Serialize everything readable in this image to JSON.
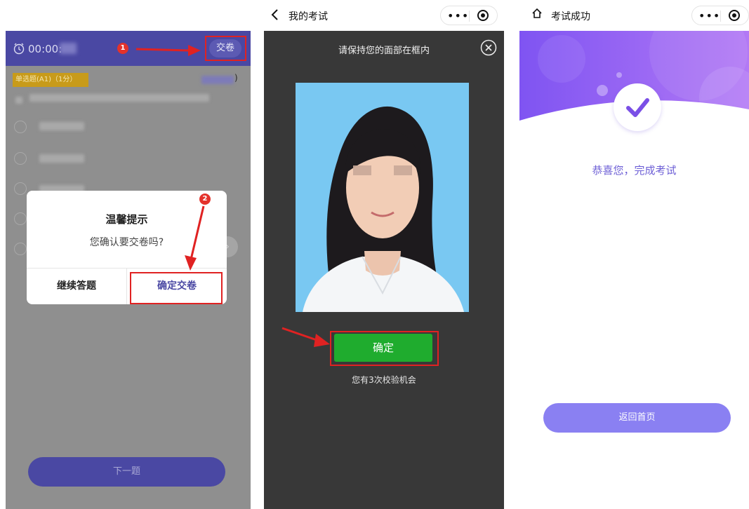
{
  "panel1": {
    "timer": "00:00:",
    "submit_label": "交卷",
    "question_type": "单选题(A1)（1分）",
    "score_suffix": ")",
    "next_label": "下一题",
    "dialog": {
      "title": "温馨提示",
      "message": "您确认要交卷吗?",
      "cancel_label": "继续答题",
      "confirm_label": "确定交卷"
    },
    "step_badges": [
      "1",
      "2"
    ],
    "colors": {
      "header": "#4a48a3",
      "overlay": "#8f8f8f",
      "annotation": "#e02222"
    }
  },
  "panel2": {
    "nav_title": "我的考试",
    "instruction": "请保持您的面部在框内",
    "confirm_label": "确定",
    "attempts_text": "您有3次校验机会",
    "colors": {
      "background": "#383838",
      "confirm": "#1fac2e",
      "photo_bg": "#79c8f2"
    }
  },
  "panel3": {
    "nav_title": "考试成功",
    "success_message": "恭喜您，完成考试",
    "home_button_label": "返回首页",
    "colors": {
      "accent": "#6d5fd6",
      "button": "#8a80f2"
    }
  },
  "icons": [
    "clock-icon",
    "back-icon",
    "close-circle-icon",
    "home-icon",
    "more-dots-icon",
    "target-icon",
    "checkmark-icon",
    "chevron-right-icon",
    "arrow-annotation-icon"
  ]
}
